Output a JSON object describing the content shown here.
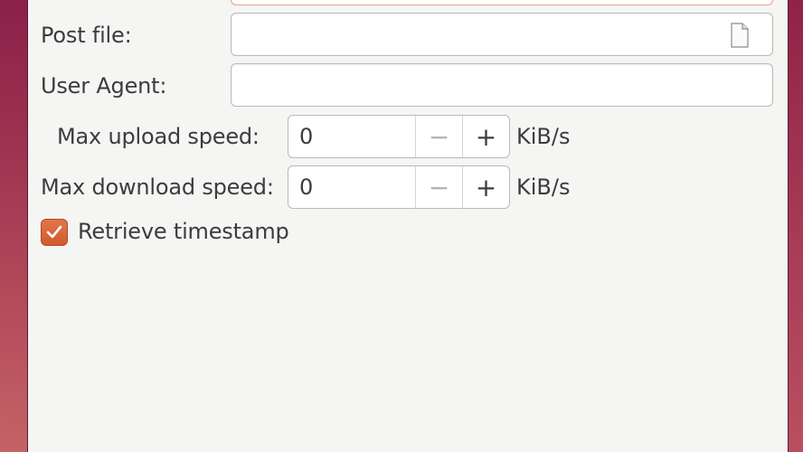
{
  "form": {
    "post_file": {
      "label": "Post file:",
      "value": "",
      "icon": "file-icon"
    },
    "user_agent": {
      "label": "User Agent:",
      "value": ""
    },
    "max_upload": {
      "label": "Max upload speed:",
      "value": "0",
      "minus": "−",
      "plus": "+",
      "unit": "KiB/s"
    },
    "max_download": {
      "label": "Max download speed:",
      "value": "0",
      "minus": "−",
      "plus": "+",
      "unit": "KiB/s"
    },
    "retrieve_timestamp": {
      "label": "Retrieve timestamp",
      "checked": true
    }
  },
  "colors": {
    "accent": "#dd6a3c",
    "focus_border": "#e9a18a",
    "desktop": "#9c3150",
    "dialog_bg": "#f5f5f4"
  }
}
